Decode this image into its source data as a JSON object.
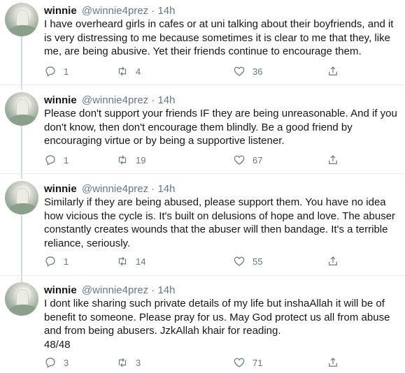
{
  "tweets": [
    {
      "name": "winnie",
      "handle": "@winnie4prez",
      "dot": "·",
      "time": "14h",
      "text": "I have overheard girls in cafes or at uni talking about their boyfriends, and it is very distressing to me because sometimes it is clear to me that they, like me, are being abusive. Yet their friends continue to encourage them.",
      "replies": "1",
      "retweets": "4",
      "likes": "36"
    },
    {
      "name": "winnie",
      "handle": "@winnie4prez",
      "dot": "·",
      "time": "14h",
      "text": "Please don't support your friends IF they are being unreasonable. And if you don't know, then don't encourage them blindly. Be a good friend by encouraging virtue or by being a supportive listener.",
      "replies": "1",
      "retweets": "19",
      "likes": "67"
    },
    {
      "name": "winnie",
      "handle": "@winnie4prez",
      "dot": "·",
      "time": "14h",
      "text": "Similarly if they are being abused, please support them. You have no idea how vicious the cycle is. It's built on delusions of hope and love. The abuser constantly creates wounds that the abuser will then bandage. It's a terrible reliance, seriously.",
      "replies": "1",
      "retweets": "14",
      "likes": "55"
    },
    {
      "name": "winnie",
      "handle": "@winnie4prez",
      "dot": "·",
      "time": "14h",
      "text": "I dont like sharing such private details of my life but inshaAllah it will be of benefit to someone. Please pray for us. May God protect us all from abuse and from being abusers. JzkAllah khair for reading.\n48/48",
      "replies": "3",
      "retweets": "3",
      "likes": "71"
    }
  ],
  "icons": {
    "reply": "reply-icon",
    "retweet": "retweet-icon",
    "like": "heart-icon",
    "share": "share-icon"
  },
  "colors": {
    "text": "#14171a",
    "muted": "#657786",
    "thread_line": "#cfd9de",
    "divider": "#e6ecf0"
  }
}
